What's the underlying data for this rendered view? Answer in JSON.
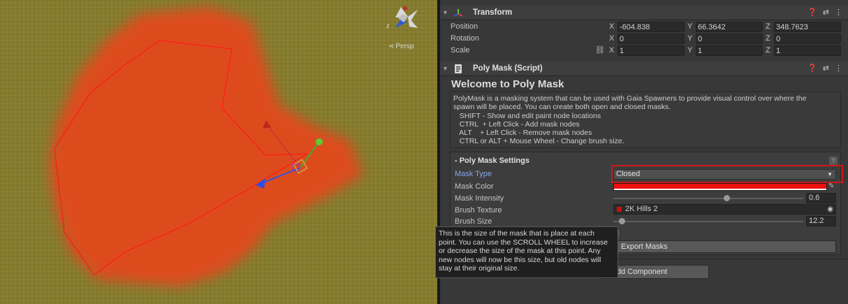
{
  "scene": {
    "persp_label": "Persp",
    "gizmo_axis_label": "z",
    "colors": {
      "ground": "#837a2e",
      "mask_fill": "#e24a1c",
      "mask_outline": "#ff1a1a",
      "accent_highlight": "#d01717"
    }
  },
  "transform": {
    "title": "Transform",
    "position": {
      "label": "Position",
      "x": "-604.838",
      "y": "66.3642",
      "z": "348.7623"
    },
    "rotation": {
      "label": "Rotation",
      "x": "0",
      "y": "0",
      "z": "0"
    },
    "scale": {
      "label": "Scale",
      "x": "1",
      "y": "1",
      "z": "1"
    },
    "axis_labels": {
      "x": "X",
      "y": "Y",
      "z": "Z"
    }
  },
  "polymask": {
    "header_title": "Poly Mask (Script)",
    "welcome_title": "Welcome to Poly Mask",
    "help_lines": [
      "PolyMask is a masking system that can be used with Gaia Spawners to provide visual control over where the",
      "spawn will be placed. You can create both open and closed masks.",
      "   SHIFT - Show and edit paint node locations",
      "   CTRL  + Left Click - Add mask nodes",
      "   ALT    + Left Click - Remove mask nodes",
      "   CTRL or ALT + Mouse Wheel - Change brush size."
    ],
    "settings": {
      "title": "- Poly Mask Settings",
      "help_icon": "?",
      "mask_type": {
        "label": "Mask Type",
        "value": "Closed"
      },
      "mask_color": {
        "label": "Mask Color",
        "value": "#ee1111"
      },
      "mask_intensity": {
        "label": "Mask Intensity",
        "value": "0.6",
        "fraction": 0.6
      },
      "brush_texture": {
        "label": "Brush Texture",
        "value": "2K Hills 2"
      },
      "brush_size": {
        "label": "Brush Size",
        "value": "12.2",
        "fraction": 0.0
      }
    },
    "export_button": "Export Masks"
  },
  "add_component": "dd Component",
  "tooltip_lines": [
    "This is the size of the mask that is place at each",
    "point. You can use the SCROLL WHEEL to increase",
    "or decrease the size of the mask at this point. Any",
    "new nodes will now be this size, but old nodes will",
    "stay at their original size."
  ]
}
